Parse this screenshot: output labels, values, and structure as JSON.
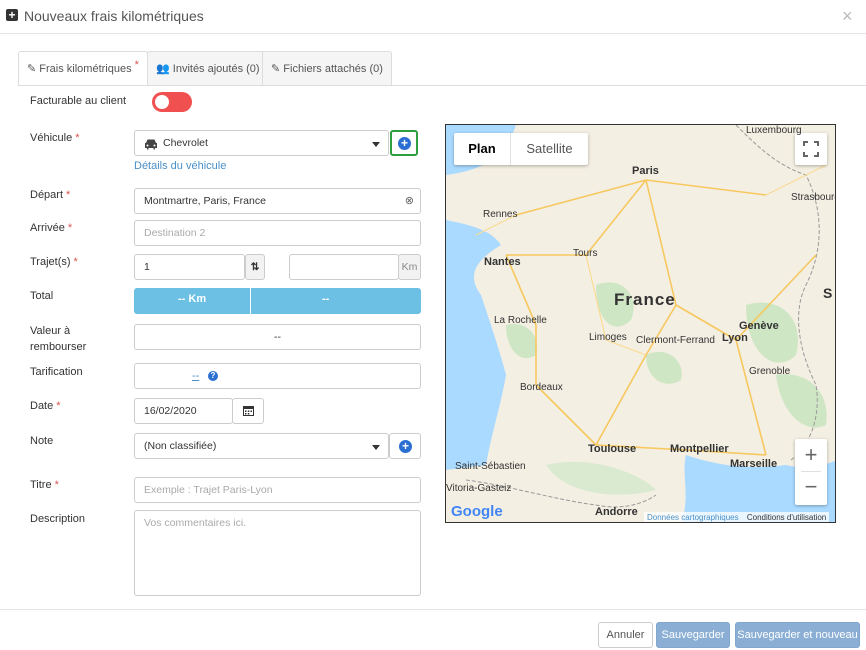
{
  "header": {
    "title": "Nouveaux frais kilométriques"
  },
  "tabs": [
    {
      "label": "Frais kilométriques",
      "required": "*"
    },
    {
      "label": "Invités ajoutés (0)"
    },
    {
      "label": "Fichiers attachés (0)"
    }
  ],
  "form": {
    "billable": {
      "label": "Facturable au client"
    },
    "vehicle": {
      "label": "Véhicule",
      "required": "*",
      "value": "Chevrolet",
      "details_link": "Détails du véhicule"
    },
    "departure": {
      "label": "Départ",
      "required": "*",
      "value": "Montmartre, Paris, France"
    },
    "arrival": {
      "label": "Arrivée",
      "required": "*",
      "placeholder": "Destination 2"
    },
    "trips": {
      "label": "Trajet(s)",
      "required": "*",
      "value": "1",
      "unit": "Km"
    },
    "total": {
      "label": "Total",
      "km": "-- Km",
      "amount": "--"
    },
    "refund": {
      "label": "Valeur à rembourser",
      "value": "--"
    },
    "pricing": {
      "label": "Tarification",
      "value": "--"
    },
    "date": {
      "label": "Date",
      "required": "*",
      "value": "16/02/2020"
    },
    "note": {
      "label": "Note",
      "value": "(Non classifiée)"
    },
    "title": {
      "label": "Titre",
      "required": "*",
      "placeholder": "Exemple : Trajet Paris-Lyon"
    },
    "description": {
      "label": "Description",
      "placeholder": "Vos commentaires ici."
    }
  },
  "map": {
    "tab_plan": "Plan",
    "tab_satellite": "Satellite",
    "country": "France",
    "cities": {
      "luxembourg": "Luxembourg",
      "paris": "Paris",
      "strasbourg": "Strasbourg",
      "rennes": "Rennes",
      "tours": "Tours",
      "nantes": "Nantes",
      "larochelle": "La Rochelle",
      "limoges": "Limoges",
      "clermont": "Clermont-Ferrand",
      "geneve": "Genève",
      "lyon": "Lyon",
      "grenoble": "Grenoble",
      "bordeaux": "Bordeaux",
      "toulouse": "Toulouse",
      "montpellier": "Montpellier",
      "marseille": "Marseille",
      "sansebastian": "Saint-Sébastien",
      "vitoria": "Vitoria-Gasteiz",
      "andorre": "Andorre",
      "s_edge": "S"
    },
    "logo": "Google",
    "attribution": "Données cartographiques",
    "terms": "Conditions d'utilisation"
  },
  "footer": {
    "cancel": "Annuler",
    "save": "Sauvegarder",
    "save_new": "Sauvegarder et nouveau"
  },
  "colors": {
    "accent": "#6cc0e4",
    "toggle_off": "#f05050",
    "button_blue": "#8aaed4",
    "highlight_green": "#2e9e3e"
  },
  "icons": {
    "header": "plus-square-icon",
    "close": "close-icon",
    "car": "car-icon",
    "clear": "clear-circle-icon",
    "swap": "sort-arrows-icon",
    "calendar": "calendar-icon",
    "help": "question-circle-icon",
    "fullscreen": "fullscreen-icon"
  }
}
